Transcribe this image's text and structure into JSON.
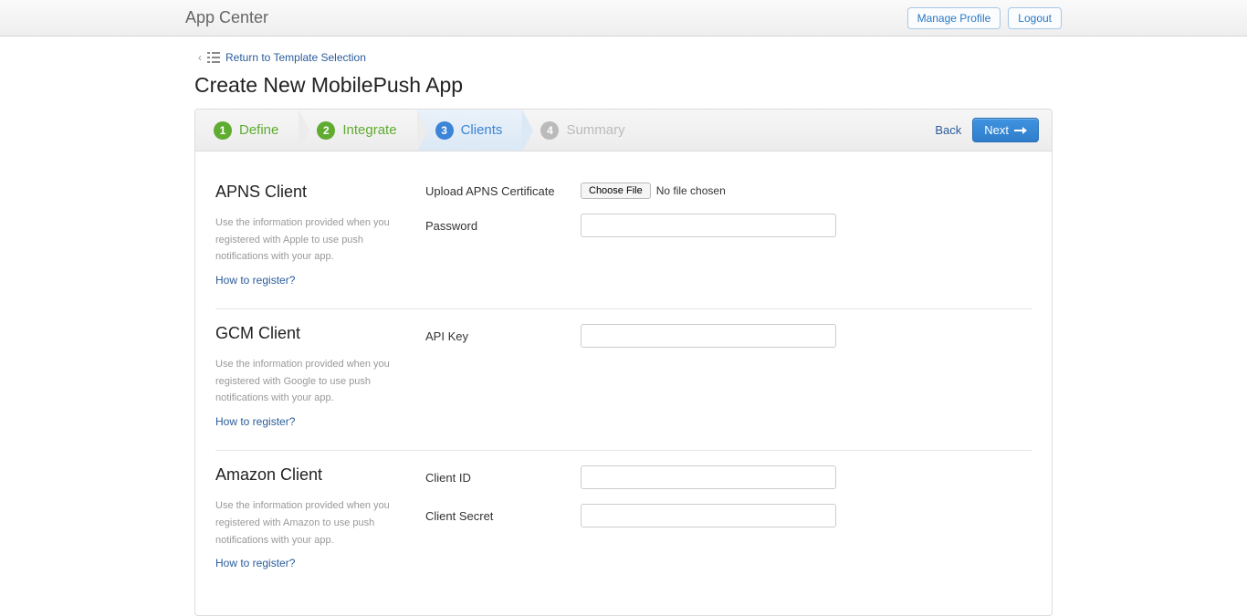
{
  "header": {
    "title": "App Center",
    "manage_profile": "Manage Profile",
    "logout": "Logout"
  },
  "breadcrumb": {
    "return_label": "Return to Template Selection"
  },
  "page": {
    "title": "Create New MobilePush App"
  },
  "steps": {
    "define": {
      "num": "1",
      "label": "Define"
    },
    "integrate": {
      "num": "2",
      "label": "Integrate"
    },
    "clients": {
      "num": "3",
      "label": "Clients"
    },
    "summary": {
      "num": "4",
      "label": "Summary"
    },
    "back": "Back",
    "next": "Next"
  },
  "apns": {
    "title": "APNS Client",
    "desc": "Use the information provided when you registered with Apple to use push notifications with your app.",
    "how": "How to register?",
    "upload_label": "Upload APNS Certificate",
    "choose_file": "Choose File",
    "no_file": "No file chosen",
    "password_label": "Password"
  },
  "gcm": {
    "title": "GCM Client",
    "desc": "Use the information provided when you registered with Google to use push notifications with your app.",
    "how": "How to register?",
    "apikey_label": "API Key"
  },
  "amazon": {
    "title": "Amazon Client",
    "desc": "Use the information provided when you registered with Amazon to use push notifications with your app.",
    "how": "How to register?",
    "clientid_label": "Client ID",
    "clientsecret_label": "Client Secret"
  }
}
